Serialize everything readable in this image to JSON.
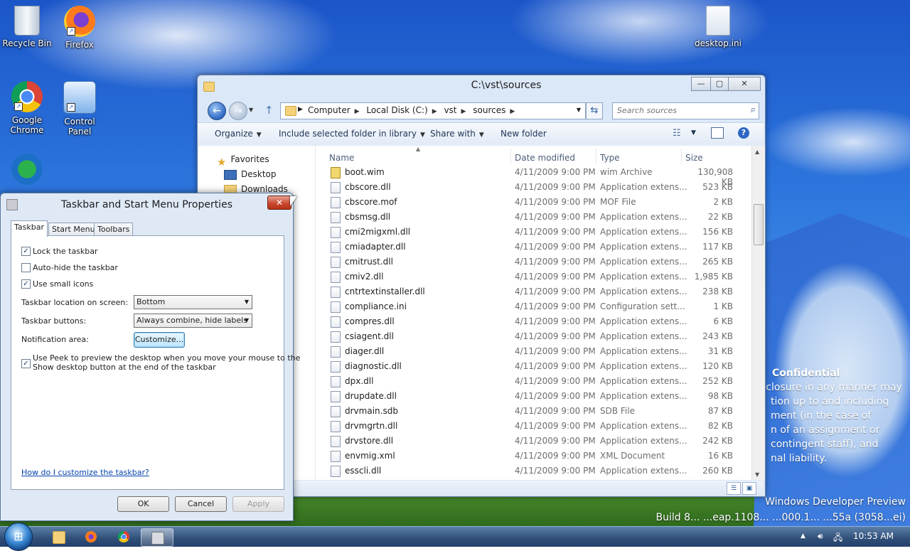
{
  "desktop": {
    "icons": [
      {
        "label": "Recycle Bin"
      },
      {
        "label": "Firefox"
      },
      {
        "label": "Google Chrome"
      },
      {
        "label": "Control Panel"
      },
      {
        "label": "desktop.ini"
      }
    ],
    "watermark": {
      "heading": "Confidential",
      "lines": [
        "sclosure in any manner may",
        "tion up to and including",
        "ment (in the case of",
        "n of an assignment or",
        "contingent staff), and",
        "nal liability."
      ]
    },
    "build_text_1": "Windows Developer Preview",
    "build_text_2": "Build 8... ...eap.1108... ...000.1... ...55a (3058...ei)"
  },
  "explorer": {
    "title": "C:\\vst\\sources",
    "breadcrumbs": [
      "Computer",
      "Local Disk (C:)",
      "vst",
      "sources"
    ],
    "search_placeholder": "Search sources",
    "commands": {
      "organize": "Organize",
      "include": "Include selected folder in library",
      "share": "Share with",
      "new_folder": "New folder"
    },
    "nav": {
      "favorites": "Favorites",
      "desktop": "Desktop",
      "downloads": "Downloads"
    },
    "columns": {
      "name": "Name",
      "date": "Date modified",
      "type": "Type",
      "size": "Size"
    },
    "files": [
      {
        "name": "boot.wim",
        "date": "4/11/2009 9:00 PM",
        "type": "wim Archive",
        "size": "130,908 KB"
      },
      {
        "name": "cbscore.dll",
        "date": "4/11/2009 9:00 PM",
        "type": "Application extens...",
        "size": "523 KB"
      },
      {
        "name": "cbscore.mof",
        "date": "4/11/2009 9:00 PM",
        "type": "MOF File",
        "size": "2 KB"
      },
      {
        "name": "cbsmsg.dll",
        "date": "4/11/2009 9:00 PM",
        "type": "Application extens...",
        "size": "22 KB"
      },
      {
        "name": "cmi2migxml.dll",
        "date": "4/11/2009 9:00 PM",
        "type": "Application extens...",
        "size": "156 KB"
      },
      {
        "name": "cmiadapter.dll",
        "date": "4/11/2009 9:00 PM",
        "type": "Application extens...",
        "size": "117 KB"
      },
      {
        "name": "cmitrust.dll",
        "date": "4/11/2009 9:00 PM",
        "type": "Application extens...",
        "size": "265 KB"
      },
      {
        "name": "cmiv2.dll",
        "date": "4/11/2009 9:00 PM",
        "type": "Application extens...",
        "size": "1,985 KB"
      },
      {
        "name": "cntrtextinstaller.dll",
        "date": "4/11/2009 9:00 PM",
        "type": "Application extens...",
        "size": "238 KB"
      },
      {
        "name": "compliance.ini",
        "date": "4/11/2009 9:00 PM",
        "type": "Configuration sett...",
        "size": "1 KB"
      },
      {
        "name": "compres.dll",
        "date": "4/11/2009 9:00 PM",
        "type": "Application extens...",
        "size": "6 KB"
      },
      {
        "name": "csiagent.dll",
        "date": "4/11/2009 9:00 PM",
        "type": "Application extens...",
        "size": "243 KB"
      },
      {
        "name": "diager.dll",
        "date": "4/11/2009 9:00 PM",
        "type": "Application extens...",
        "size": "31 KB"
      },
      {
        "name": "diagnostic.dll",
        "date": "4/11/2009 9:00 PM",
        "type": "Application extens...",
        "size": "120 KB"
      },
      {
        "name": "dpx.dll",
        "date": "4/11/2009 9:00 PM",
        "type": "Application extens...",
        "size": "252 KB"
      },
      {
        "name": "drupdate.dll",
        "date": "4/11/2009 9:00 PM",
        "type": "Application extens...",
        "size": "98 KB"
      },
      {
        "name": "drvmain.sdb",
        "date": "4/11/2009 9:00 PM",
        "type": "SDB File",
        "size": "87 KB"
      },
      {
        "name": "drvmgrtn.dll",
        "date": "4/11/2009 9:00 PM",
        "type": "Application extens...",
        "size": "82 KB"
      },
      {
        "name": "drvstore.dll",
        "date": "4/11/2009 9:00 PM",
        "type": "Application extens...",
        "size": "242 KB"
      },
      {
        "name": "envmig.xml",
        "date": "4/11/2009 9:00 PM",
        "type": "XML Document",
        "size": "16 KB"
      },
      {
        "name": "esscli.dll",
        "date": "4/11/2009 9:00 PM",
        "type": "Application extens...",
        "size": "260 KB"
      }
    ]
  },
  "dialog": {
    "title": "Taskbar and Start Menu Properties",
    "tabs": [
      "Taskbar",
      "Start Menu",
      "Toolbars"
    ],
    "lock_label": "Lock the taskbar",
    "lock_checked": "✓",
    "autohide_label": "Auto-hide the taskbar",
    "small_icons_label": "Use small icons",
    "small_icons_checked": "✓",
    "location_label": "Taskbar location on screen:",
    "location_value": "Bottom",
    "buttons_label": "Taskbar buttons:",
    "buttons_value": "Always combine, hide labels",
    "notification_label": "Notification area:",
    "customize_button": "Customize...",
    "peek_line1": "Use Peek to preview the desktop when you move your mouse to the",
    "peek_line2": "Show desktop button at the end of the taskbar",
    "peek_checked": "✓",
    "help_link": "How do I customize the taskbar?",
    "ok": "OK",
    "cancel": "Cancel",
    "apply": "Apply"
  },
  "taskbar": {
    "clock": "10:53 AM"
  },
  "icons": {
    "accent": "#2e68c4",
    "close_red": "#c9452b"
  }
}
